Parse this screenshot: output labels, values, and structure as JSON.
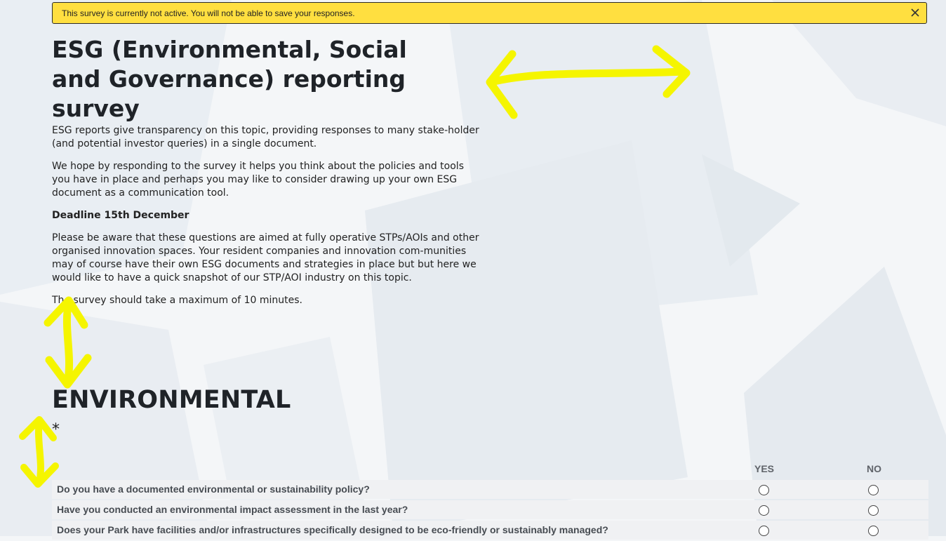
{
  "banner": {
    "message": "This survey is currently not active. You will not be able to save your responses.",
    "close_icon": "close-icon"
  },
  "survey": {
    "title": "ESG (Environmental, Social and Governance) reporting survey",
    "intro": "ESG reports give transparency on this topic, providing responses to many stake-holder (and potential investor queries) in a single document.",
    "paragraph2": "We hope by responding to the survey it helps you think about the policies and tools you have in place and perhaps you may like to consider drawing up your own ESG document as a communication tool.",
    "deadline": "Deadline 15th December",
    "paragraph3": "Please be aware that these questions are aimed at fully operative STPs/AOIs and other organised innovation spaces. Your resident companies and innovation com-munities may of course have their own ESG documents and strategies in place but but here we would like to have a quick snapshot of our STP/AOI industry on this topic.",
    "duration": "The survey should take a maximum of 10 minutes."
  },
  "section": {
    "title": "ENVIRONMENTAL",
    "required_marker": "*",
    "columns": {
      "yes": "YES",
      "no": "NO"
    },
    "questions": [
      "Do you have a documented environmental or sustainability policy?",
      "Have you conducted an environmental impact assessment in the last year?",
      "Does your Park have facilities and/or infrastructures specifically designed to be eco-friendly or sustainably managed?"
    ]
  },
  "colors": {
    "banner_bg": "#ffdf40",
    "annotation": "#f5f500",
    "page_bg": "#f4f6f8"
  }
}
